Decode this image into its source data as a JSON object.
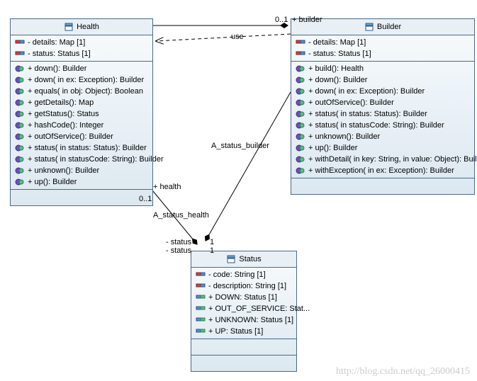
{
  "chart_data": {
    "type": "uml_class_diagram",
    "classes": [
      {
        "name": "Health",
        "attributes": [
          "- details: Map [1]",
          "- status: Status [1]"
        ],
        "operations": [
          "+ down(): Builder",
          "+ down( in ex: Exception): Builder",
          "+ equals( in obj: Object): Boolean",
          "+ getDetails(): Map",
          "+ getStatus(): Status",
          "+ hashCode(): Integer",
          "+ outOfService(): Builder",
          "+ status( in status: Status): Builder",
          "+ status( in statusCode: String): Builder",
          "+ unknown(): Builder",
          "+ up(): Builder"
        ]
      },
      {
        "name": "Builder",
        "attributes": [
          "- details: Map [1]",
          "- status: Status [1]"
        ],
        "operations": [
          "+ build(): Health",
          "+ down(): Builder",
          "+ down( in ex: Exception): Builder",
          "+ outOfService(): Builder",
          "+ status( in status: Status): Builder",
          "+ status( in statusCode: String): Builder",
          "+ unknown(): Builder",
          "+ up(): Builder",
          "+ withDetail( in key: String,  in value: Object): Builder",
          "+ withException( in ex: Exception): Builder"
        ]
      },
      {
        "name": "Status",
        "attributes": [
          "- code: String [1]",
          "- description: String [1]",
          "+ DOWN: Status [1]",
          "+ OUT_OF_SERVICE: Stat...",
          "+ UNKNOWN: Status [1]",
          "+ UP: Status [1]"
        ],
        "operations": []
      }
    ],
    "relationships": [
      {
        "from": "Builder",
        "to": "Health",
        "label": "use",
        "type": "dependency"
      },
      {
        "from": "Health",
        "to": "Builder",
        "role": "+ builder",
        "multiplicity": "0..1",
        "type": "association"
      },
      {
        "from": "Health",
        "to": "Status",
        "role": "- status",
        "multiplicity": "1",
        "label": "A_status_health",
        "type": "association",
        "end": "+ health 0..1"
      },
      {
        "from": "Builder",
        "to": "Status",
        "role": "- status",
        "multiplicity": "1",
        "label": "A_status_builder",
        "type": "association"
      }
    ]
  },
  "health": {
    "name": "Health",
    "details": "- details: Map [1]",
    "status": "- status: Status [1]",
    "m0": "+ down(): Builder",
    "m1": "+ down(  in ex: Exception): Builder",
    "m2": "+ equals(  in obj: Object): Boolean",
    "m3": "+ getDetails(): Map",
    "m4": "+ getStatus(): Status",
    "m5": "+ hashCode(): Integer",
    "m6": "+ outOfService(): Builder",
    "m7": "+ status(  in status: Status): Builder",
    "m8": "+ status(  in statusCode: String): Builder",
    "m9": "+ unknown(): Builder",
    "m10": "+ up(): Builder"
  },
  "builder": {
    "name": "Builder",
    "details": "- details: Map [1]",
    "status": "- status: Status [1]",
    "m0": "+ build(): Health",
    "m1": "+ down(): Builder",
    "m2": "+ down(  in ex: Exception): Builder",
    "m3": "+ outOfService(): Builder",
    "m4": "+ status(  in status: Status): Builder",
    "m5": "+ status(  in statusCode: String): Builder",
    "m6": "+ unknown(): Builder",
    "m7": "+ up(): Builder",
    "m8": "+ withDetail(  in key: String,   in value: Object): Builder",
    "m9": "+ withException(  in ex: Exception): Builder"
  },
  "status": {
    "name": "Status",
    "a0": "- code: String [1]",
    "a1": "- description: String [1]",
    "a2": "+ DOWN: Status [1]",
    "a3": "+ OUT_OF_SERVICE: Stat...",
    "a4": "+ UNKNOWN: Status [1]",
    "a5": "+ UP: Status [1]"
  },
  "labels": {
    "use": "use",
    "builder_role": "+ builder",
    "mult01": "0..1",
    "health_role": "+ health",
    "a_status_builder": "A_status_builder",
    "a_status_health": "A_status_health",
    "status_role1": "- status",
    "status_role2": "- status",
    "mult1a": "1",
    "mult1b": "1"
  },
  "watermark": "http://blog.csdn.net/qq_26000415"
}
